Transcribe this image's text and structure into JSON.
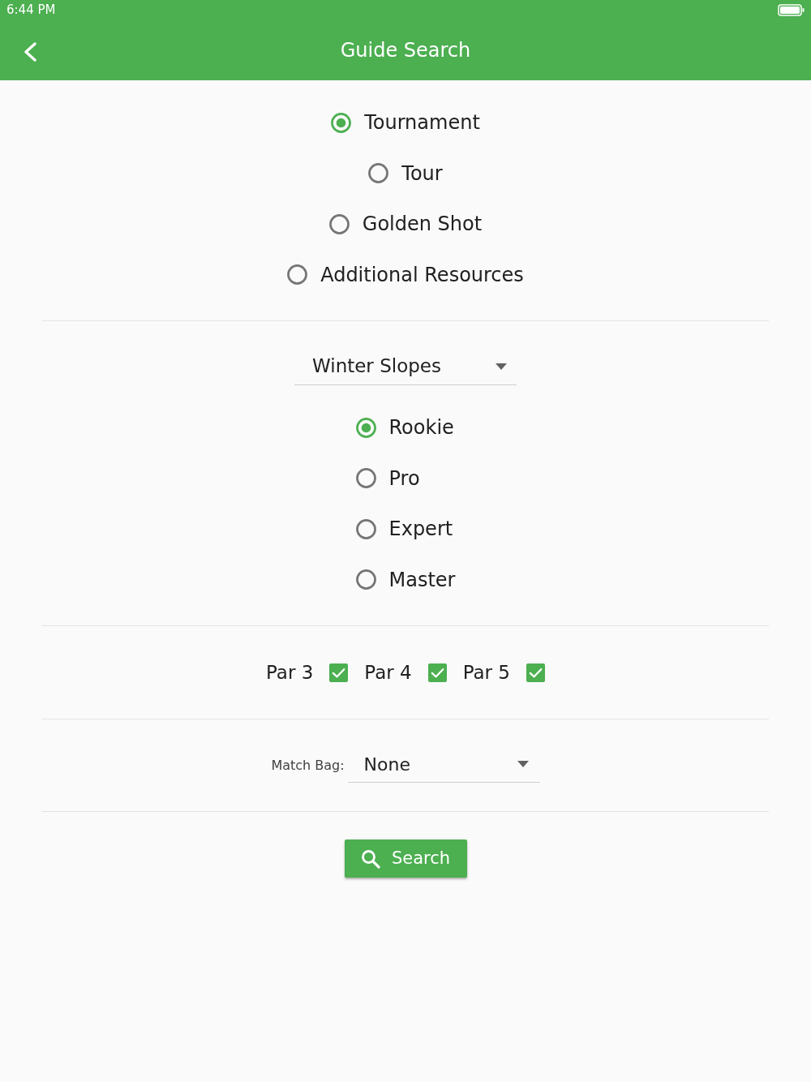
{
  "status_bar": {
    "time": "6:44 PM"
  },
  "app_bar": {
    "title": "Guide Search"
  },
  "guide_types": [
    {
      "label": "Tournament",
      "selected": true
    },
    {
      "label": "Tour",
      "selected": false
    },
    {
      "label": "Golden Shot",
      "selected": false
    },
    {
      "label": "Additional Resources",
      "selected": false
    }
  ],
  "course_dropdown": {
    "value": "Winter Slopes"
  },
  "levels": [
    {
      "label": "Rookie",
      "selected": true
    },
    {
      "label": "Pro",
      "selected": false
    },
    {
      "label": "Expert",
      "selected": false
    },
    {
      "label": "Master",
      "selected": false
    }
  ],
  "pars": [
    {
      "label": "Par 3",
      "checked": true
    },
    {
      "label": "Par 4",
      "checked": true
    },
    {
      "label": "Par 5",
      "checked": true
    }
  ],
  "match_bag": {
    "label": "Match Bag:",
    "value": "None"
  },
  "search_button": {
    "label": "Search"
  }
}
